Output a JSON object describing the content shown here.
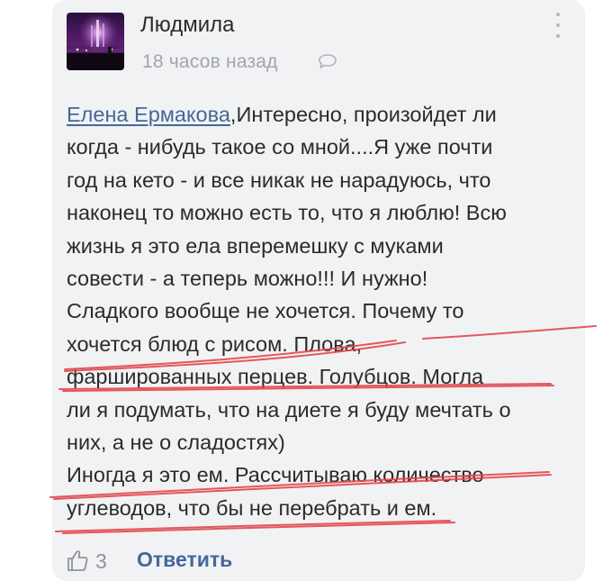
{
  "comment": {
    "author": "Людмила",
    "time": "18 часов назад",
    "mention": "Елена Ермакова",
    "text": ",Интересно, произойдет ли\nкогда - нибудь такое со мной....Я уже почти\nгод на кето - и все никак не нарадуюсь, что\nнаконец то можно есть то, что я люблю! Всю\nжизнь я это ела вперемешку с муками\nсовести - а теперь можно!!! И нужно!\nСладкого вообще не хочется. Почему то\nхочется блюд с рисом. Плова,\nфаршированных перцев. Голубцов.  Могла\nли я подумать, что на диете я буду мечтать о\nних, а не о сладостях)\nИногда я это ем. Рассчитываю количество\nуглеводов, что бы не перебрать и ем.",
    "likes": "3",
    "reply_label": "Ответить"
  },
  "icons": {
    "avatar": "avatar-photo",
    "reply_bubble": "comment-bubble-icon",
    "menu": "more-vertical-icon",
    "like": "thumbs-up-icon"
  },
  "colors": {
    "card_bg": "#f1f2f4",
    "link": "#45679a",
    "muted": "#a2a5aa",
    "text": "#2b2b2b",
    "annotation_red": "#e2474b"
  }
}
